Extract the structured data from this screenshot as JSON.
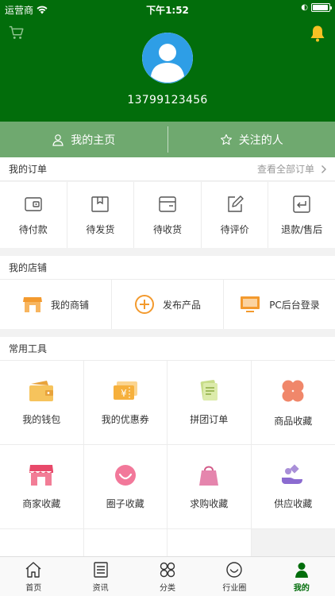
{
  "status_bar": {
    "carrier": "运营商",
    "time": "下午1:52",
    "battery_level": 0.95
  },
  "profile": {
    "phone": "13799123456"
  },
  "tabs": [
    {
      "label": "我的主页",
      "icon": "person-icon"
    },
    {
      "label": "关注的人",
      "icon": "star-icon"
    }
  ],
  "orders": {
    "title": "我的订单",
    "view_all": "查看全部订单",
    "items": [
      {
        "label": "待付款",
        "icon": "wallet-icon"
      },
      {
        "label": "待发货",
        "icon": "package-icon"
      },
      {
        "label": "待收货",
        "icon": "receive-icon"
      },
      {
        "label": "待评价",
        "icon": "edit-icon"
      },
      {
        "label": "退款/售后",
        "icon": "return-icon"
      }
    ]
  },
  "shop": {
    "title": "我的店铺",
    "items": [
      {
        "label": "我的商铺",
        "icon": "store-icon"
      },
      {
        "label": "发布产品",
        "icon": "plus-circle-icon"
      },
      {
        "label": "PC后台登录",
        "icon": "monitor-icon"
      }
    ]
  },
  "tools": {
    "title": "常用工具",
    "items": [
      {
        "label": "我的钱包",
        "icon": "wallet-icon"
      },
      {
        "label": "我的优惠券",
        "icon": "coupon-icon"
      },
      {
        "label": "拼团订单",
        "icon": "group-order-icon"
      },
      {
        "label": "商品收藏",
        "icon": "clover-icon"
      },
      {
        "label": "商家收藏",
        "icon": "shop-icon"
      },
      {
        "label": "圈子收藏",
        "icon": "smile-icon"
      },
      {
        "label": "求购收藏",
        "icon": "bag-icon"
      },
      {
        "label": "供应收藏",
        "icon": "supply-icon"
      }
    ]
  },
  "bottom_nav": [
    {
      "label": "首页",
      "icon": "home-icon"
    },
    {
      "label": "资讯",
      "icon": "news-icon"
    },
    {
      "label": "分类",
      "icon": "category-icon"
    },
    {
      "label": "行业圈",
      "icon": "circle-icon"
    },
    {
      "label": "我的",
      "icon": "profile-icon",
      "active": true
    }
  ],
  "colors": {
    "brand": "#026d0b",
    "tab_bar": "#6fa96f",
    "accent_orange": "#f39a2e"
  }
}
